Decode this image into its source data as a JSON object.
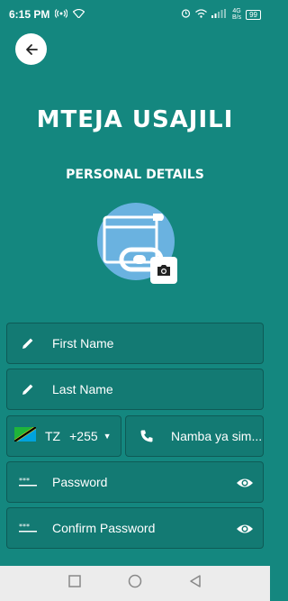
{
  "status_bar": {
    "time": "6:15 PM",
    "network_label": "4G",
    "speed_label": "B/s",
    "battery": "99"
  },
  "header": {
    "title": "MTEJA USAJILI",
    "subtitle": "PERSONAL DETAILS"
  },
  "form": {
    "first_name_placeholder": "First Name",
    "last_name_placeholder": "Last Name",
    "country_code": "TZ",
    "dial_code": "+255",
    "phone_placeholder": "Namba ya sim...",
    "password_placeholder": "Password",
    "confirm_password_placeholder": "Confirm Password"
  },
  "colors": {
    "background": "#14877f",
    "field_background": "#137a73",
    "nav_bar": "#ececec"
  }
}
